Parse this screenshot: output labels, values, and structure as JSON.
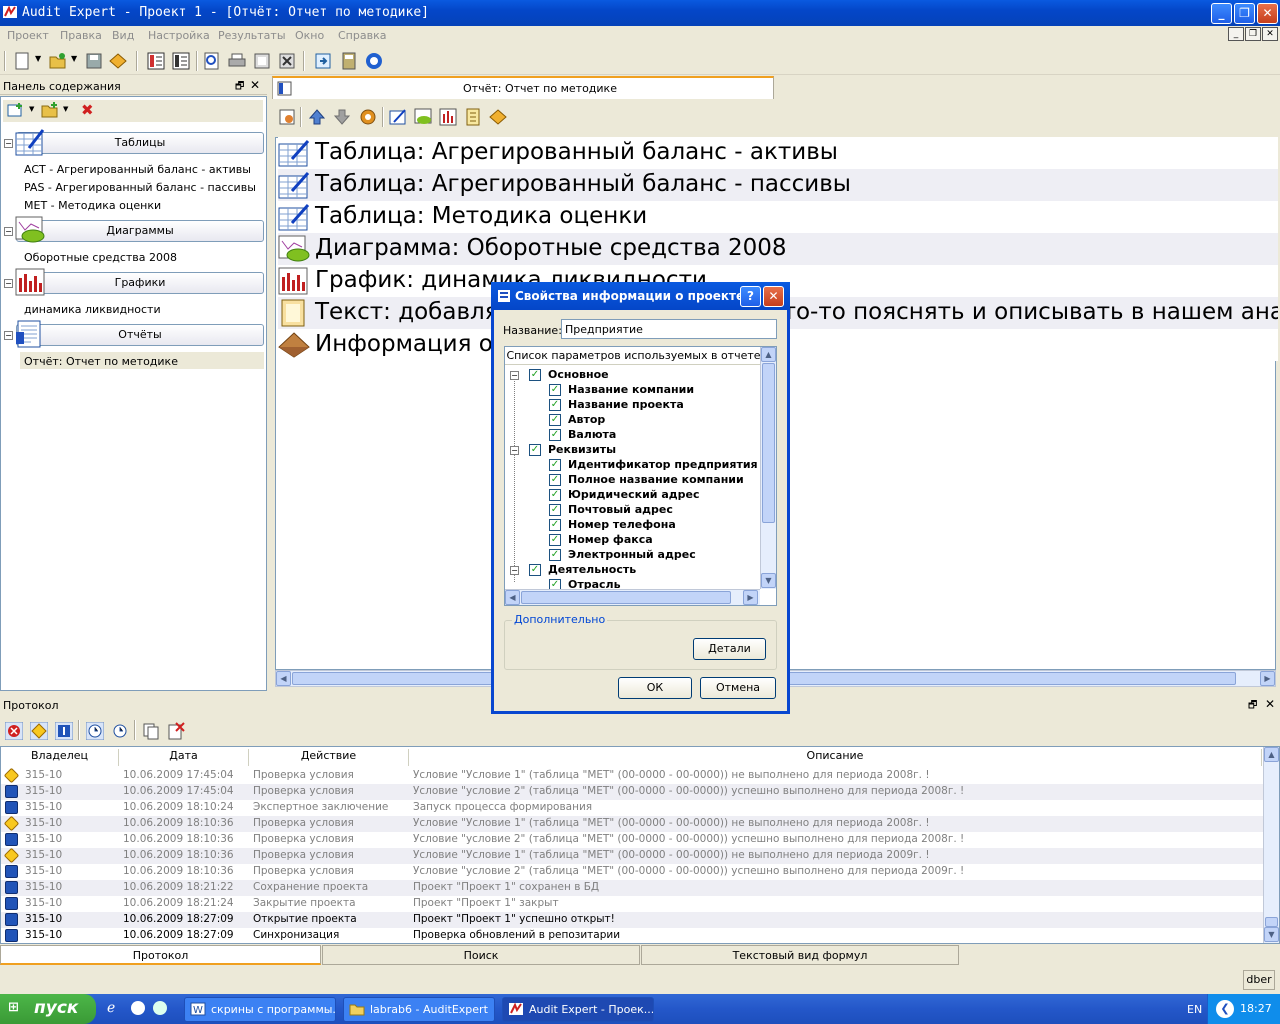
{
  "window": {
    "title": "Audit Expert - Проект 1  - [Отчёт: Отчет по методике]"
  },
  "menu": [
    "Проект",
    "Правка",
    "Вид",
    "Настройка",
    "Результаты",
    "Окно",
    "Справка"
  ],
  "left_panel": {
    "title": "Панель содержания",
    "groups": [
      {
        "label": "Таблицы",
        "items": [
          "ACT - Агрегированный баланс - активы",
          "PAS - Агрегированный баланс - пассивы",
          "MET - Методика оценки"
        ]
      },
      {
        "label": "Диаграммы",
        "items": [
          "Оборотные средства 2008"
        ]
      },
      {
        "label": "Графики",
        "items": [
          "динамика ликвидности"
        ]
      },
      {
        "label": "Отчёты",
        "items": [
          "Отчёт: Отчет по методике"
        ]
      }
    ]
  },
  "report": {
    "tab_label": "Отчёт: Отчет по методике",
    "rows": [
      "Таблица: Агрегированный баланс - активы",
      "Таблица: Агрегированный баланс - пассивы",
      "Таблица: Методика оценки",
      "Диаграмма: Оборотные средства 2008",
      "График: динамика ликвидности",
      "Текст: добавляем текст, если нужно что-то пояснять и описывать в нашем анализе",
      "Информация о проекте"
    ]
  },
  "dialog": {
    "title": "Свойства информации о проекте",
    "name_label": "Название:",
    "name_value": "Предприятие",
    "list_header": "Список параметров используемых в отчете",
    "tree": [
      {
        "label": "Основное",
        "level": 0
      },
      {
        "label": "Название компании",
        "level": 1
      },
      {
        "label": "Название проекта",
        "level": 1
      },
      {
        "label": "Автор",
        "level": 1
      },
      {
        "label": "Валюта",
        "level": 1
      },
      {
        "label": "Реквизиты",
        "level": 0
      },
      {
        "label": "Идентификатор предприятия",
        "level": 1
      },
      {
        "label": "Полное название компании",
        "level": 1
      },
      {
        "label": "Юридический адрес",
        "level": 1
      },
      {
        "label": "Почтовый адрес",
        "level": 1
      },
      {
        "label": "Номер телефона",
        "level": 1
      },
      {
        "label": "Номер факса",
        "level": 1
      },
      {
        "label": "Электронный адрес",
        "level": 1
      },
      {
        "label": "Деятельность",
        "level": 0
      },
      {
        "label": "Отрасль",
        "level": 1
      }
    ],
    "additional_label": "Дополнительно",
    "details_button": "Детали",
    "ok_button": "ОК",
    "cancel_button": "Отмена"
  },
  "protocol": {
    "title": "Протокол",
    "columns": [
      "Владелец",
      "Дата",
      "Действие",
      "Описание"
    ],
    "rows": [
      {
        "type": "warn",
        "owner": "315-10",
        "date": "10.06.2009 17:45:04",
        "action": "Проверка условия",
        "desc": "Условие \"Условие 1\" (таблица \"MET\" (00-0000 - 00-0000)) не выполнено для периода 2008г. !"
      },
      {
        "type": "info",
        "owner": "315-10",
        "date": "10.06.2009 17:45:04",
        "action": "Проверка условия",
        "desc": "Условие \"условие 2\" (таблица \"MET\" (00-0000 - 00-0000)) успешно выполнено для периода 2008г. !"
      },
      {
        "type": "info",
        "owner": "315-10",
        "date": "10.06.2009 18:10:24",
        "action": "Экспертное заключение",
        "desc": "Запуск процесса формирования"
      },
      {
        "type": "warn",
        "owner": "315-10",
        "date": "10.06.2009 18:10:36",
        "action": "Проверка условия",
        "desc": "Условие \"Условие 1\" (таблица \"MET\" (00-0000 - 00-0000)) не выполнено для периода 2008г. !"
      },
      {
        "type": "info",
        "owner": "315-10",
        "date": "10.06.2009 18:10:36",
        "action": "Проверка условия",
        "desc": "Условие \"условие 2\" (таблица \"MET\" (00-0000 - 00-0000)) успешно выполнено для периода 2008г. !"
      },
      {
        "type": "warn",
        "owner": "315-10",
        "date": "10.06.2009 18:10:36",
        "action": "Проверка условия",
        "desc": "Условие \"Условие 1\" (таблица \"MET\" (00-0000 - 00-0000)) не выполнено для периода 2009г. !"
      },
      {
        "type": "info",
        "owner": "315-10",
        "date": "10.06.2009 18:10:36",
        "action": "Проверка условия",
        "desc": "Условие \"условие 2\" (таблица \"MET\" (00-0000 - 00-0000)) успешно выполнено для периода 2009г. !"
      },
      {
        "type": "info",
        "owner": "315-10",
        "date": "10.06.2009 18:21:22",
        "action": "Сохранение проекта",
        "desc": "Проект \"Проект 1\" сохранен в БД"
      },
      {
        "type": "info",
        "owner": "315-10",
        "date": "10.06.2009 18:21:24",
        "action": "Закрытие проекта",
        "desc": "Проект \"Проект 1\" закрыт"
      },
      {
        "type": "info",
        "owner": "315-10",
        "date": "10.06.2009 18:27:09",
        "action": "Открытие проекта",
        "desc": "Проект \"Проект 1\" успешно открыт!"
      },
      {
        "type": "info",
        "owner": "315-10",
        "date": "10.06.2009 18:27:09",
        "action": "Синхронизация",
        "desc": "Проверка обновлений в репозитарии"
      }
    ],
    "tabs": [
      "Протокол",
      "Поиск",
      "Текстовый вид формул"
    ]
  },
  "status": {
    "user": "dber"
  },
  "taskbar": {
    "start": "пуск",
    "tasks": [
      "скрины с программы...",
      "labrab6 - AuditExpert",
      "Audit Expert - Проек..."
    ],
    "lang": "EN",
    "time": "18:27"
  }
}
